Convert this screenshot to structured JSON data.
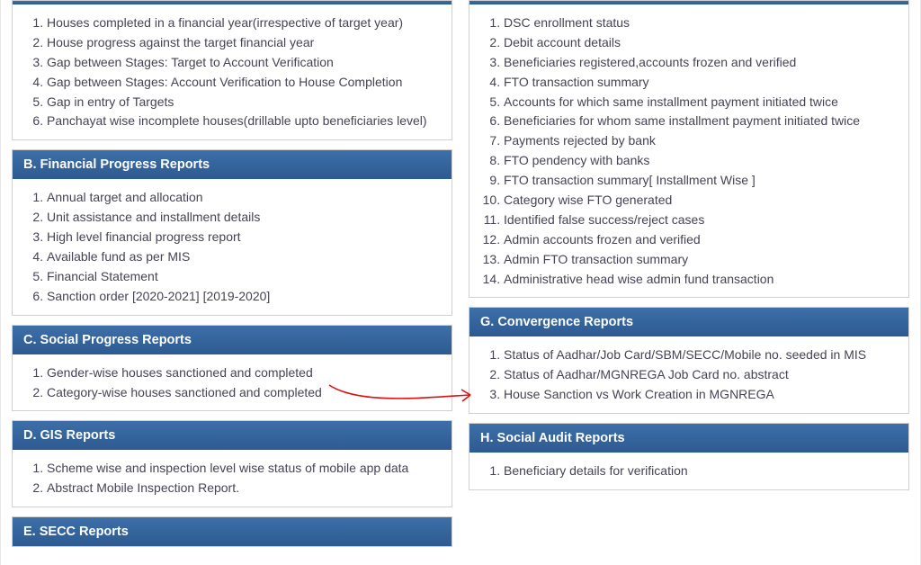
{
  "left": {
    "sectionA": {
      "title": "",
      "items": [
        "Houses completed in a financial year(irrespective of target year)",
        "House progress against the target financial year",
        "Gap between Stages: Target to Account Verification",
        "Gap between Stages: Account Verification to House Completion",
        "Gap in entry of Targets",
        "Panchayat wise incomplete houses(drillable upto beneficiaries level)"
      ]
    },
    "sectionB": {
      "title": "B. Financial Progress Reports",
      "items": [
        "Annual target and allocation",
        "Unit assistance and installment details",
        "High level financial progress report",
        "Available fund as per MIS",
        "Financial Statement",
        "Sanction order [2020-2021] [2019-2020]"
      ]
    },
    "sectionC": {
      "title": "C. Social Progress Reports",
      "items": [
        "Gender-wise houses sanctioned and completed",
        "Category-wise houses sanctioned and completed"
      ]
    },
    "sectionD": {
      "title": "D. GIS Reports",
      "items": [
        "Scheme wise and inspection level wise status of mobile app data",
        "Abstract Mobile Inspection Report."
      ]
    },
    "sectionE": {
      "title": "E. SECC Reports",
      "items": []
    }
  },
  "right": {
    "sectionF": {
      "title": "",
      "items": [
        "DSC enrollment status",
        "Debit account details",
        "Beneficiaries registered,accounts frozen and verified",
        "FTO transaction summary",
        "Accounts for which same installment payment initiated twice",
        "Beneficiaries for whom same installment payment initiated twice",
        "Payments rejected by bank",
        "FTO pendency with banks",
        "FTO transaction summary[ Installment Wise ]",
        "Category wise FTO generated",
        "Identified false success/reject cases",
        "Admin accounts frozen and verified",
        "Admin FTO transaction summary",
        "Administrative head wise admin fund transaction"
      ]
    },
    "sectionG": {
      "title": "G. Convergence Reports",
      "items": [
        "Status of Aadhar/Job Card/SBM/SECC/Mobile no. seeded in MIS",
        "Status of Aadhar/MGNREGA Job Card no. abstract",
        "House Sanction vs Work Creation in MGNREGA"
      ]
    },
    "sectionH": {
      "title": "H. Social Audit Reports",
      "items": [
        "Beneficiary details for verification"
      ]
    }
  }
}
